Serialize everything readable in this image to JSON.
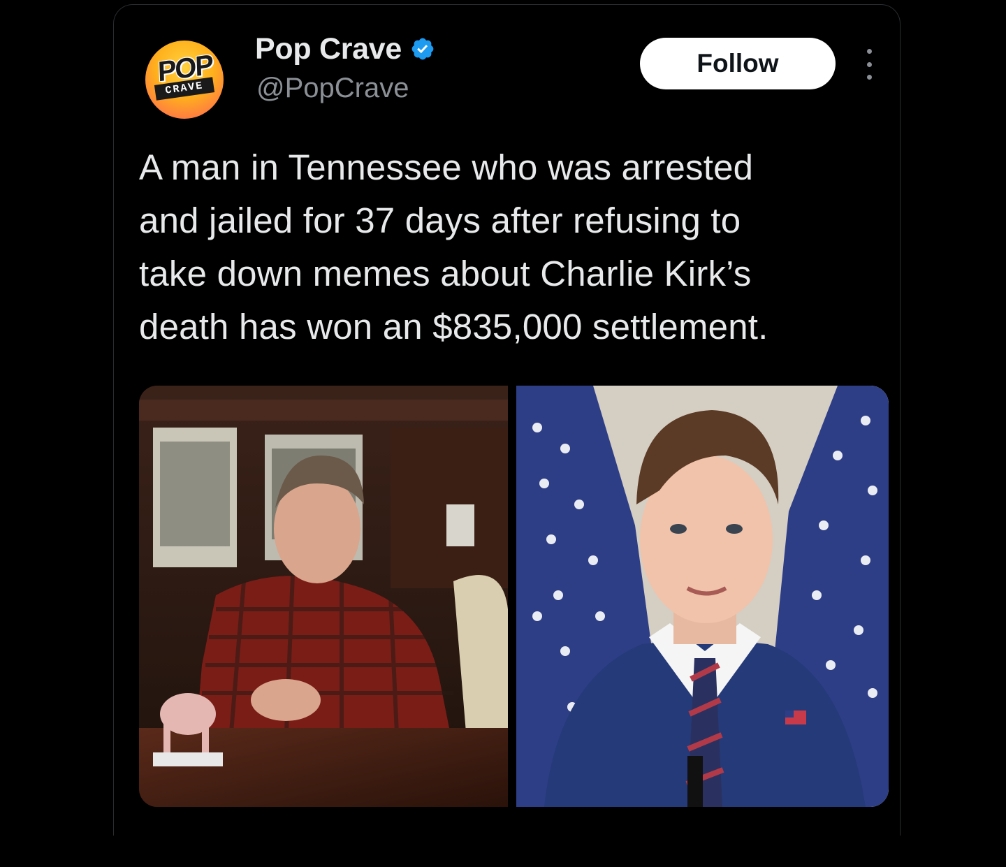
{
  "post": {
    "author": {
      "display_name": "Pop Crave",
      "handle": "@PopCrave",
      "verified": true,
      "avatar_logo_top": "POP",
      "avatar_logo_bottom": "CRAVE"
    },
    "follow_label": "Follow",
    "more_icon": "more-dots-icon",
    "text_lines": [
      "A man in Tennessee who was arrested",
      "and jailed for 37 days after refusing to",
      "take down memes about Charlie Kirk’s",
      "death has won an $835,000 settlement."
    ],
    "media": [
      {
        "kind": "photo",
        "subject": "man-in-plaid-shirt-at-table"
      },
      {
        "kind": "photo",
        "subject": "man-in-suit-before-flags"
      }
    ]
  },
  "colors": {
    "background": "#000000",
    "text": "#e7e9ea",
    "secondary_text": "#8b9096",
    "verified_blue": "#1d9bf0",
    "follow_bg": "#ffffff",
    "follow_text": "#0f1419"
  }
}
